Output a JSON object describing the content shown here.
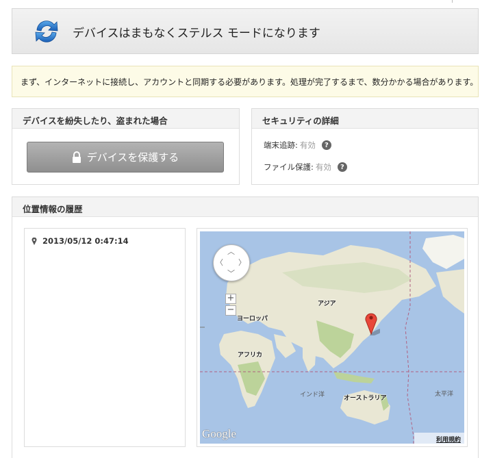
{
  "header": {
    "title": "デバイスはまもなくステルス モードになります",
    "icon": "sync-icon"
  },
  "notice": {
    "text": "まず、インターネットに接続し、アカウントと同期する必要があります。処理が完了するまで、数分かかる場合があります。"
  },
  "lost_panel": {
    "title": "デバイスを紛失したり、盗まれた場合",
    "protect_button": "デバイスを保護する"
  },
  "security_panel": {
    "title": "セキュリティの詳細",
    "rows": [
      {
        "label": "端末追跡:",
        "value": "有効"
      },
      {
        "label": "ファイル保護:",
        "value": "有効"
      }
    ]
  },
  "history_panel": {
    "title": "位置情報の履歴",
    "locations": [
      {
        "timestamp": "2013/05/12 0:47:14"
      }
    ]
  },
  "map": {
    "labels": {
      "asia": "アジア",
      "europe": "ヨーロッパ",
      "africa": "アフリカ",
      "australia": "オーストラリア"
    },
    "oceans": {
      "indian": "インド洋",
      "pacific": "太平洋"
    },
    "zoom_in": "+",
    "zoom_out": "−",
    "pan_arrows": {
      "up": "︿",
      "down": "﹀",
      "left": "〈",
      "right": "〉"
    },
    "attribution": "Google",
    "terms": "利用規約",
    "colors": {
      "ocean": "#a8c4e6",
      "land": "#e9e7d4",
      "forest": "#bcd39a",
      "marker": "#e8473a"
    }
  }
}
